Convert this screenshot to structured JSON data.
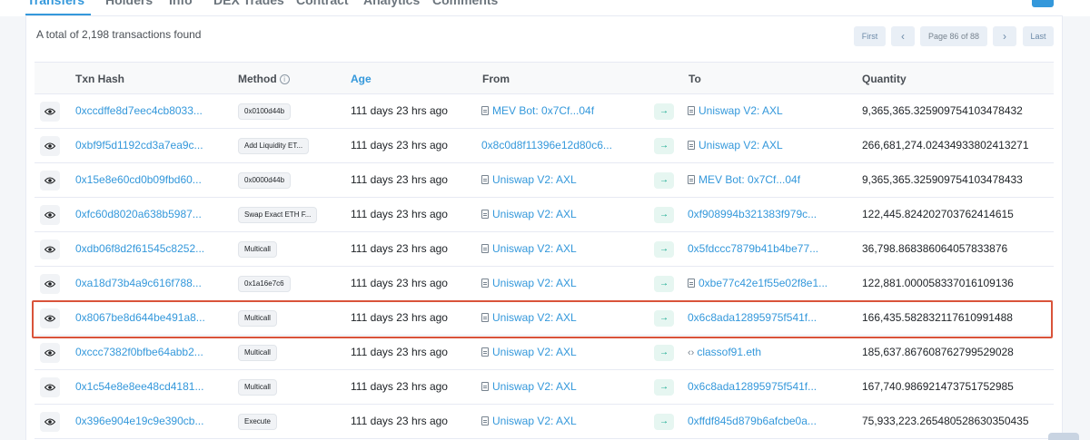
{
  "tabs": [
    {
      "label": "Transfers",
      "active": true
    },
    {
      "label": "Holders",
      "active": false
    },
    {
      "label": "Info",
      "active": false
    },
    {
      "label": "DEX Trades",
      "active": false
    },
    {
      "label": "Contract",
      "active": false
    },
    {
      "label": "Analytics",
      "active": false
    },
    {
      "label": "Comments",
      "active": false
    }
  ],
  "summary": "A total of 2,198 transactions found",
  "pagination": {
    "first": "First",
    "prev": "‹",
    "page_info": "Page 86 of 88",
    "next": "›",
    "last": "Last"
  },
  "columns": {
    "hash": "Txn Hash",
    "method": "Method",
    "age": "Age",
    "from": "From",
    "to": "To",
    "quantity": "Quantity"
  },
  "icons": {
    "view": "eye-icon",
    "info": "info-icon",
    "contract": "document-icon",
    "ens": "code-icon",
    "transfer": "arrow-right-icon"
  },
  "colors": {
    "link": "#3498db",
    "highlight": "#d9533a",
    "transfer_badge": "#00a186"
  },
  "rows": [
    {
      "hash": "0xccdffe8d7eec4cb8033...",
      "method": "0x0100d44b",
      "age": "111 days 23 hrs ago",
      "from": "MEV Bot: 0x7Cf...04f",
      "from_contract": true,
      "to": "Uniswap V2: AXL",
      "to_contract": true,
      "to_ens": false,
      "quantity": "9,365,365.325909754103478432"
    },
    {
      "hash": "0xbf9f5d1192cd3a7ea9c...",
      "method": "Add Liquidity ET...",
      "age": "111 days 23 hrs ago",
      "from": "0x8c0d8f11396e12d80c6...",
      "from_contract": false,
      "to": "Uniswap V2: AXL",
      "to_contract": true,
      "to_ens": false,
      "quantity": "266,681,274.02434933802413271"
    },
    {
      "hash": "0x15e8e60cd0b09fbd60...",
      "method": "0x0000d44b",
      "age": "111 days 23 hrs ago",
      "from": "Uniswap V2: AXL",
      "from_contract": true,
      "to": "MEV Bot: 0x7Cf...04f",
      "to_contract": true,
      "to_ens": false,
      "quantity": "9,365,365.325909754103478433"
    },
    {
      "hash": "0xfc60d8020a638b5987...",
      "method": "Swap Exact ETH F...",
      "age": "111 days 23 hrs ago",
      "from": "Uniswap V2: AXL",
      "from_contract": true,
      "to": "0xf908994b321383f979c...",
      "to_contract": false,
      "to_ens": false,
      "quantity": "122,445.824202703762414615"
    },
    {
      "hash": "0xdb06f8d2f61545c8252...",
      "method": "Multicall",
      "age": "111 days 23 hrs ago",
      "from": "Uniswap V2: AXL",
      "from_contract": true,
      "to": "0x5fdccc7879b41b4be77...",
      "to_contract": false,
      "to_ens": false,
      "quantity": "36,798.868386064057833876"
    },
    {
      "hash": "0xa18d73b4a9c616f788...",
      "method": "0x1a16e7c6",
      "age": "111 days 23 hrs ago",
      "from": "Uniswap V2: AXL",
      "from_contract": true,
      "to": "0xbe77c42e1f55e02f8e1...",
      "to_contract": true,
      "to_ens": false,
      "quantity": "122,881.000058337016109136"
    },
    {
      "hash": "0x8067be8d644be491a8...",
      "method": "Multicall",
      "age": "111 days 23 hrs ago",
      "from": "Uniswap V2: AXL",
      "from_contract": true,
      "to": "0x6c8ada12895975f541f...",
      "to_contract": false,
      "to_ens": false,
      "quantity": "166,435.582832117610991488",
      "highlighted": true
    },
    {
      "hash": "0xccc7382f0bfbe64abb2...",
      "method": "Multicall",
      "age": "111 days 23 hrs ago",
      "from": "Uniswap V2: AXL",
      "from_contract": true,
      "to": "classof91.eth",
      "to_contract": false,
      "to_ens": true,
      "quantity": "185,637.867608762799529028"
    },
    {
      "hash": "0x1c54e8e8ee48cd4181...",
      "method": "Multicall",
      "age": "111 days 23 hrs ago",
      "from": "Uniswap V2: AXL",
      "from_contract": true,
      "to": "0x6c8ada12895975f541f...",
      "to_contract": false,
      "to_ens": false,
      "quantity": "167,740.986921473751752985"
    },
    {
      "hash": "0x396e904e19c9e390cb...",
      "method": "Execute",
      "age": "111 days 23 hrs ago",
      "from": "Uniswap V2: AXL",
      "from_contract": true,
      "to": "0xffdf845d879b6afcbe0a...",
      "to_contract": false,
      "to_ens": false,
      "quantity": "75,933,223.265480528630350435"
    }
  ]
}
